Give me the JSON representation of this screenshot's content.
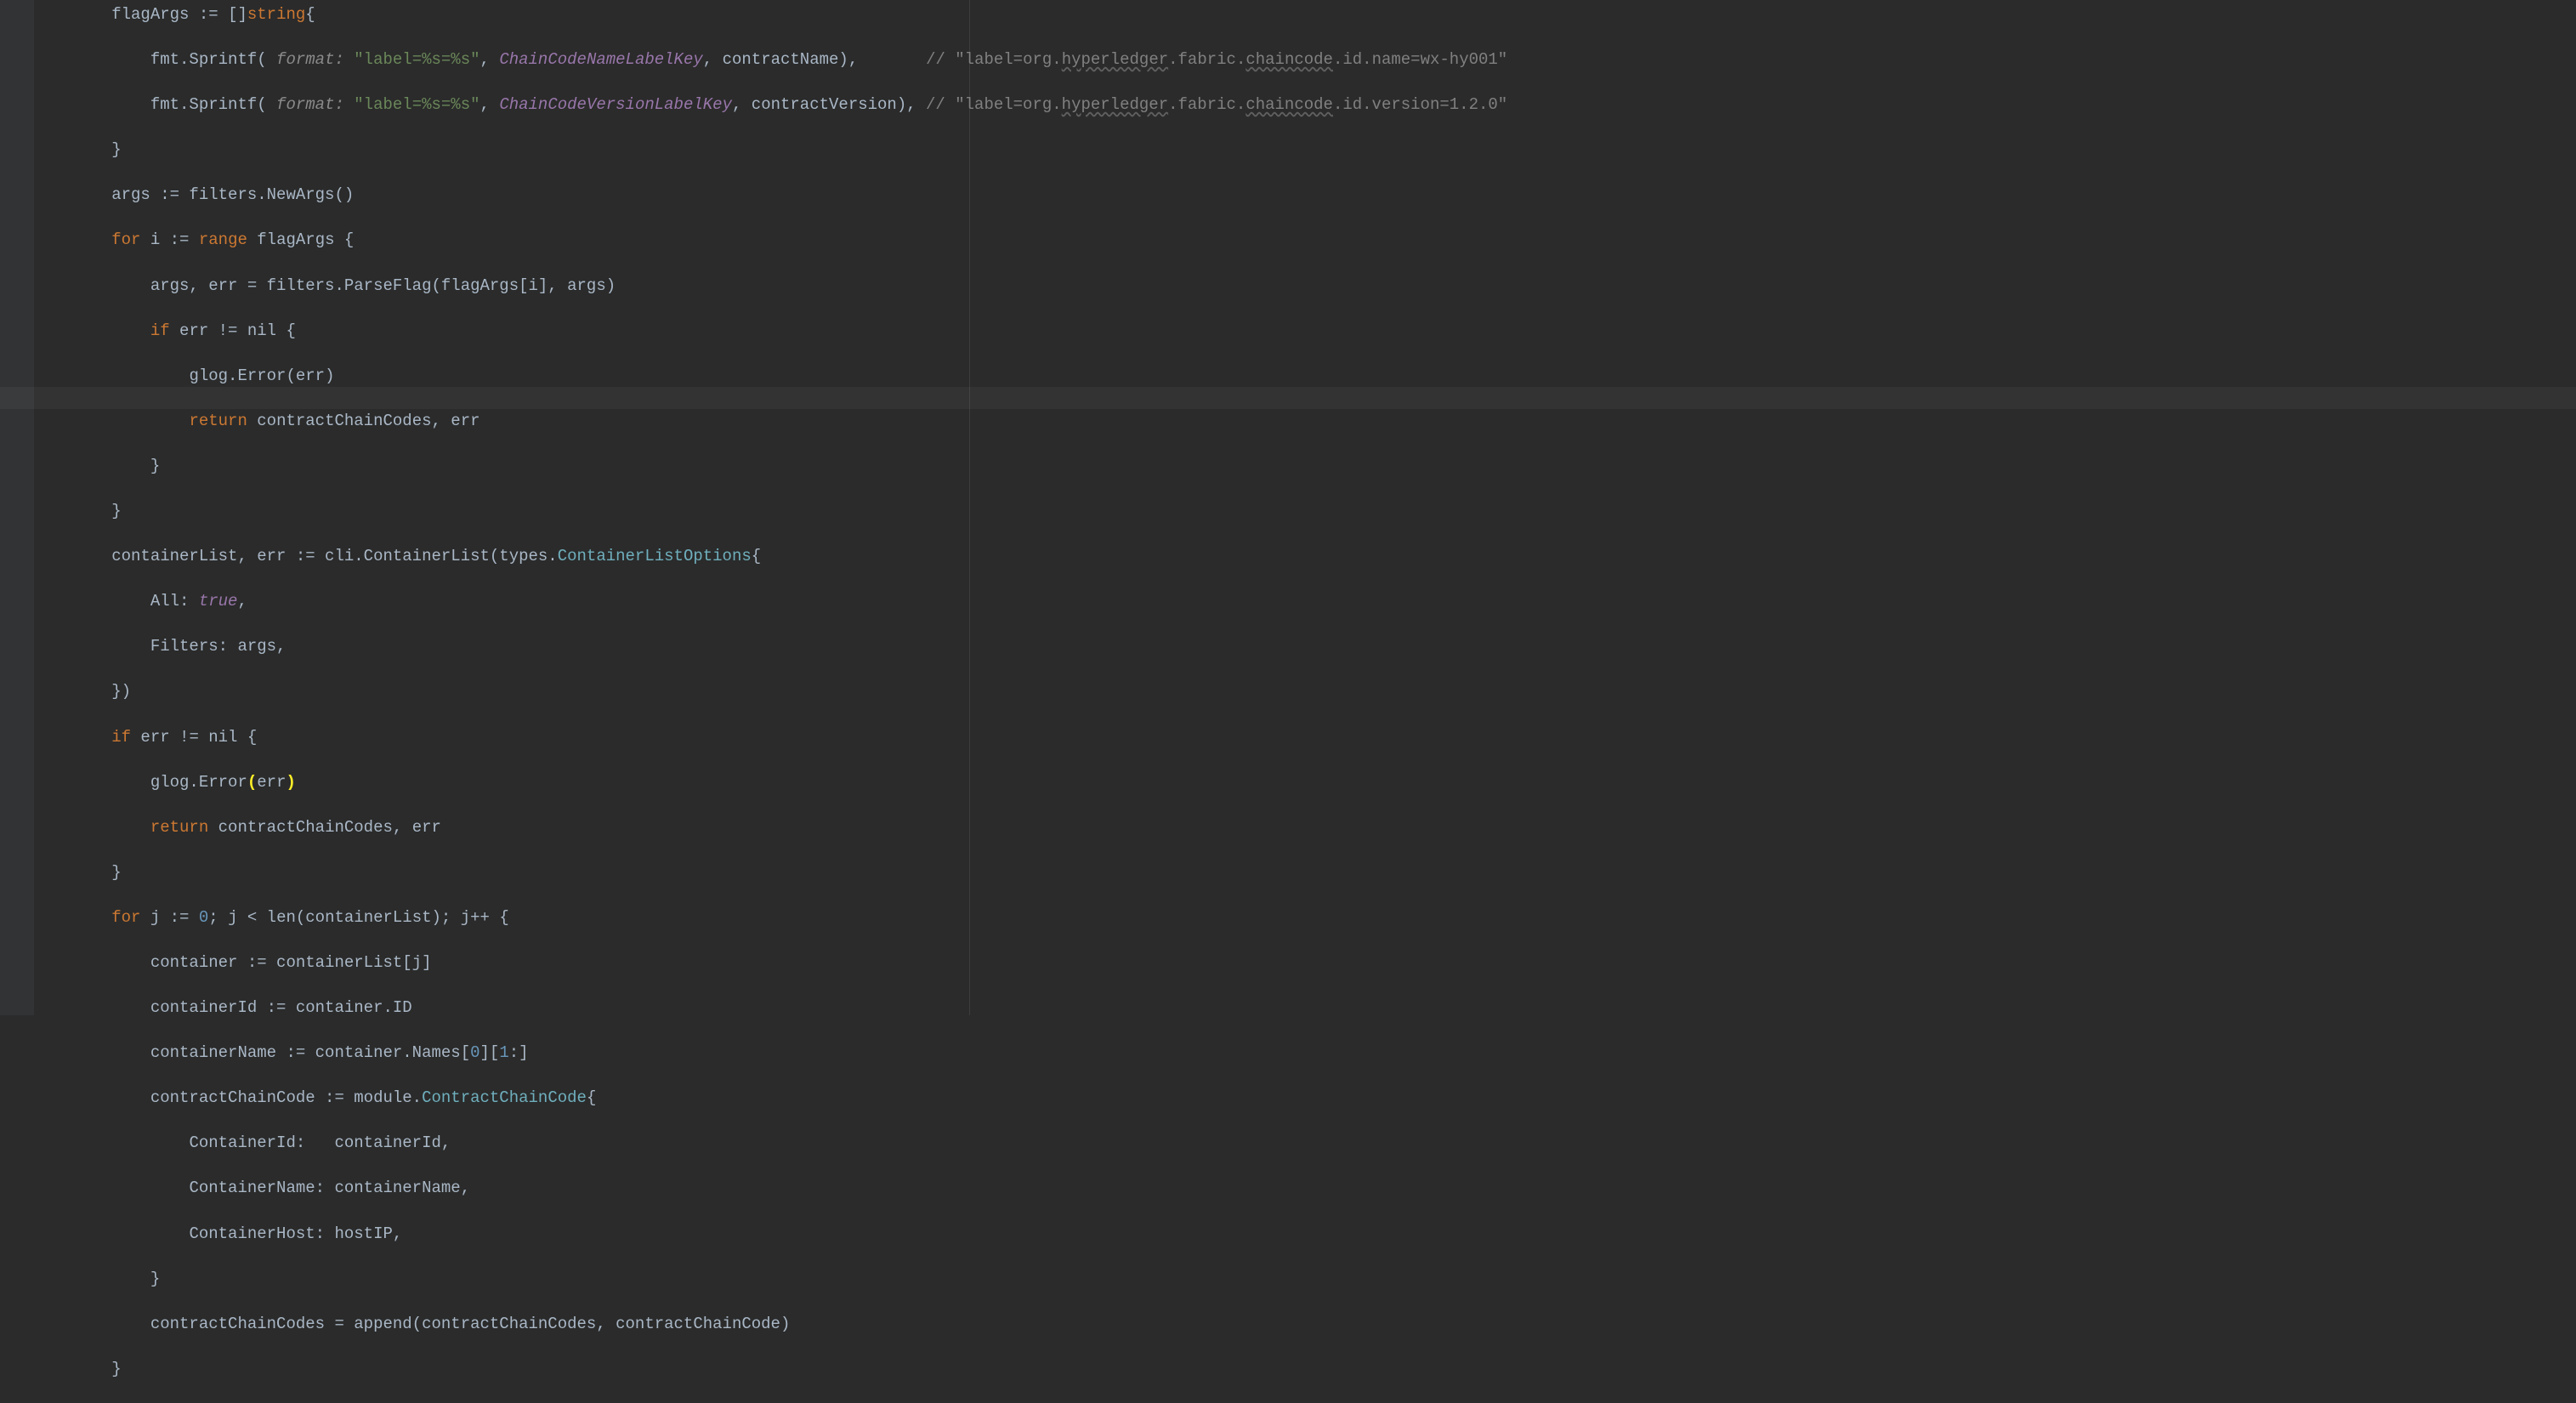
{
  "indent": {
    "l1": "        ",
    "l2": "            ",
    "l3": "                ",
    "l4": "                    "
  },
  "t": {
    "flagArgs": "flagArgs ",
    "declop": ":= ",
    "lbstring": "[]",
    "string": "string",
    "lbrace": "{",
    "fmtSprintf": "fmt.Sprintf(",
    "hint_format": " format: ",
    "fmt_str": "\"label=%s=%s\"",
    "comma": ", ",
    "chainNameKey": "ChainCodeNameLabelKey",
    "chainVerKey": "ChainCodeVersionLabelKey",
    "contractName": "contractName),",
    "contractVersion": "contractVersion), ",
    "cmt1a": "// \"label=org.",
    "cmt_hl": "hyperledger",
    "cmt1b": ".fabric.",
    "cmt_cc": "chaincode",
    "cmt1c_name": ".id.name=wx-hy001\"",
    "cmt1c_ver": ".id.version=1.2.0\"",
    "rbrace": "}",
    "args_decl": "args := filters.NewArgs()",
    "for": "for",
    "range": "range",
    "i_decl": " i := ",
    "flagArgs_l": " flagArgs {",
    "parseFlag": "args, err = filters.ParseFlag(flagArgs[i], args)",
    "if": "if",
    "err_nil": " err != nil {",
    "glogErr": "glog.Error(err)",
    "glogErr_open": "glog.Error",
    "err_in_paren": "err",
    "return": "return",
    "return_cc": " contractChainCodes, err",
    "cl_decl": "containerList, err := cli.ContainerList(types.",
    "clOpt": "ContainerListOptions",
    "lbrace2": "{",
    "all": "All: ",
    "true": "true",
    "comma_only": ",",
    "filters_args": "Filters: args,",
    "close_paren": "})",
    "for_j": " j := ",
    "zero": "0",
    "j_cond": "; j < len(containerList); j++ {",
    "container_j": "container := containerList[j]",
    "containerId": "containerId := container.ID",
    "containerName": "containerName := container.Names[",
    "n0": "0",
    "brk_1": "][",
    "n1": "1",
    "cn_end": ":]",
    "ccc_decl": "contractChainCode := module.",
    "ccc_type": "ContractChainCode",
    "f_cid": "ContainerId:   containerId,",
    "f_cname": "ContainerName: containerName,",
    "f_chost": "ContainerHost: hostIP,",
    "append_line": "contractChainCodes = append(contractChainCodes, contractChainCode)",
    "pad_name": "       ",
    "pad_ver": " "
  },
  "highlight_line_index": 17
}
